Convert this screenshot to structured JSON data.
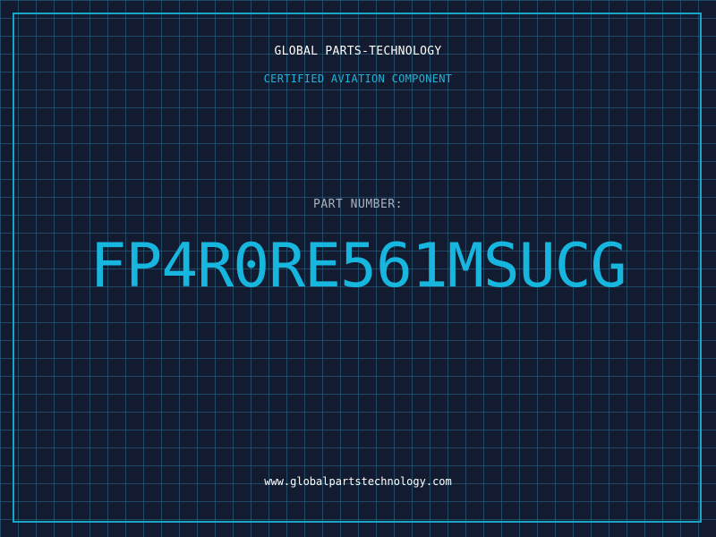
{
  "header": {
    "company_name": "GLOBAL PARTS-TECHNOLOGY",
    "tagline": "CERTIFIED AVIATION COMPONENT"
  },
  "part": {
    "label": "PART NUMBER:",
    "number": "FP4R0RE561MSUCG"
  },
  "footer": {
    "website": "www.globalpartstechnology.com"
  },
  "colors": {
    "background": "#121b30",
    "grid": "#286e8c",
    "accent": "#17b6de",
    "frame": "#1aa6c9",
    "label": "#a8b3c2",
    "text": "#ffffff"
  }
}
